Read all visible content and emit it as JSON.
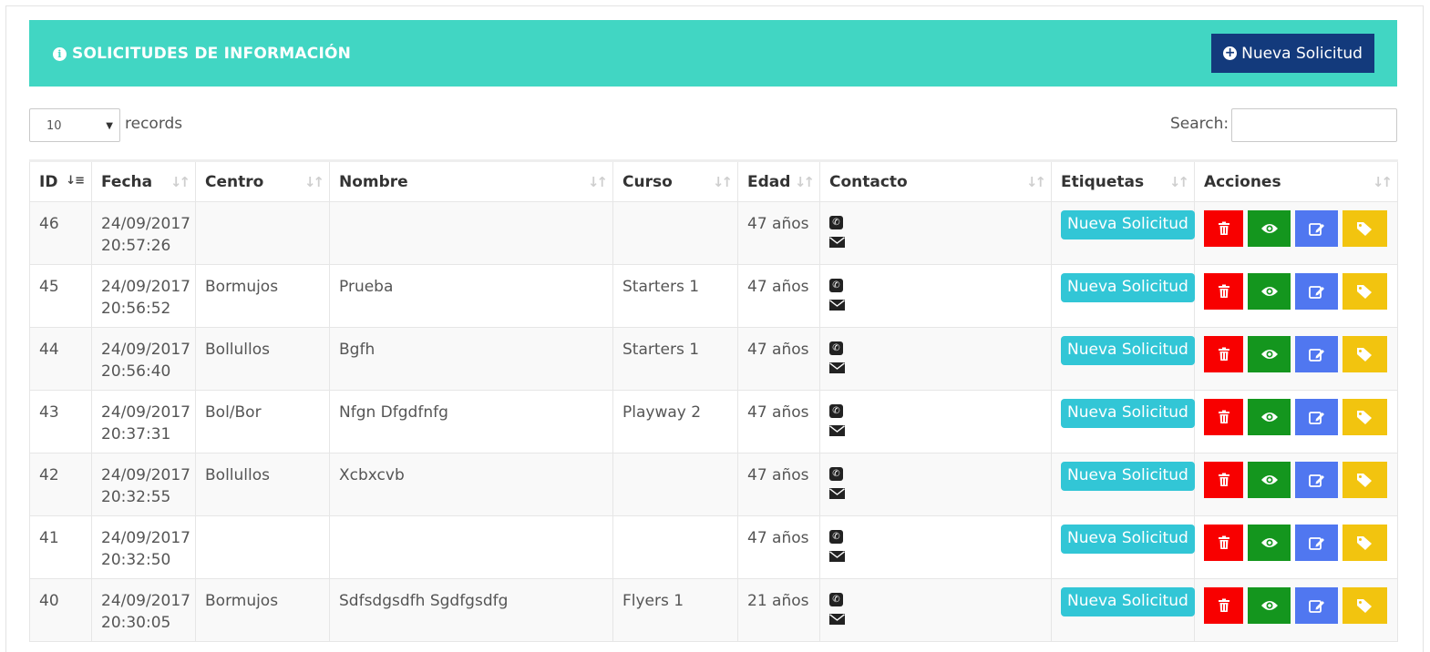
{
  "header": {
    "title": "SOLICITUDES DE INFORMACIÓN",
    "new_button_label": "Nueva Solicitud"
  },
  "controls": {
    "page_length": "10",
    "records_label": "records",
    "search_label": "Search:",
    "search_value": ""
  },
  "table": {
    "columns": [
      "ID",
      "Fecha",
      "Centro",
      "Nombre",
      "Curso",
      "Edad",
      "Contacto",
      "Etiquetas",
      "Acciones"
    ],
    "rows": [
      {
        "id": "46",
        "fecha_date": "24/09/2017",
        "fecha_time": "20:57:26",
        "centro": "",
        "nombre": "",
        "curso": "",
        "edad": "47 años",
        "etiqueta": "Nueva Solicitud"
      },
      {
        "id": "45",
        "fecha_date": "24/09/2017",
        "fecha_time": "20:56:52",
        "centro": "Bormujos",
        "nombre": "Prueba",
        "curso": "Starters 1",
        "edad": "47 años",
        "etiqueta": "Nueva Solicitud"
      },
      {
        "id": "44",
        "fecha_date": "24/09/2017",
        "fecha_time": "20:56:40",
        "centro": "Bollullos",
        "nombre": "Bgfh",
        "curso": "Starters 1",
        "edad": "47 años",
        "etiqueta": "Nueva Solicitud"
      },
      {
        "id": "43",
        "fecha_date": "24/09/2017",
        "fecha_time": "20:37:31",
        "centro": "Bol/Bor",
        "nombre": "Nfgn Dfgdfnfg",
        "curso": "Playway 2",
        "edad": "47 años",
        "etiqueta": "Nueva Solicitud"
      },
      {
        "id": "42",
        "fecha_date": "24/09/2017",
        "fecha_time": "20:32:55",
        "centro": "Bollullos",
        "nombre": "Xcbxcvb",
        "curso": "",
        "edad": "47 años",
        "etiqueta": "Nueva Solicitud"
      },
      {
        "id": "41",
        "fecha_date": "24/09/2017",
        "fecha_time": "20:32:50",
        "centro": "",
        "nombre": "",
        "curso": "",
        "edad": "47 años",
        "etiqueta": "Nueva Solicitud"
      },
      {
        "id": "40",
        "fecha_date": "24/09/2017",
        "fecha_time": "20:30:05",
        "centro": "Bormujos",
        "nombre": "Sdfsdgsdfh Sgdfgsdfg",
        "curso": "Flyers 1",
        "edad": "21 años",
        "etiqueta": "Nueva Solicitud"
      }
    ]
  },
  "colors": {
    "header_bg": "#41d6c3",
    "new_button_bg": "#133a7c",
    "tag_badge_bg": "#32c6d6",
    "delete_bg": "#f80000",
    "view_bg": "#14961e",
    "edit_bg": "#5077f0",
    "tag_bg": "#f2c40f"
  },
  "icons": {
    "header": "info-circle-icon",
    "new_button": "plus-circle-icon",
    "contact": [
      "phone-icon",
      "envelope-icon"
    ],
    "actions": [
      "trash-icon",
      "eye-icon",
      "edit-icon",
      "tag-icon"
    ]
  }
}
